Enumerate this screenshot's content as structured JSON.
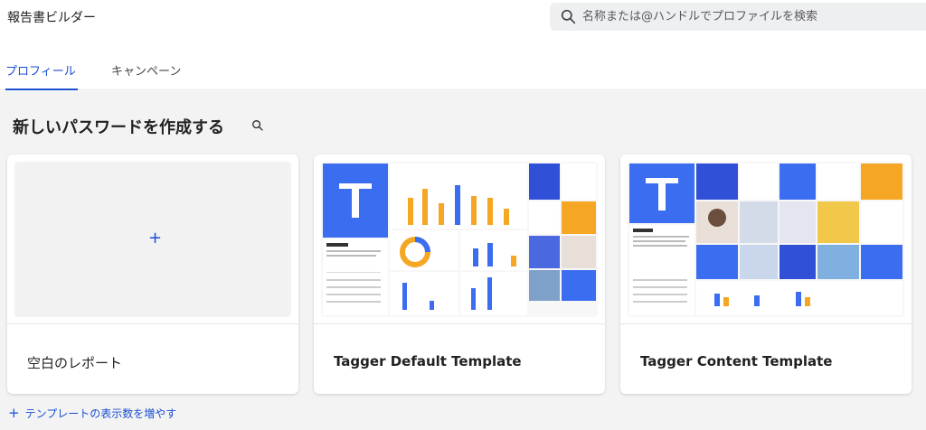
{
  "header": {
    "app_title": "報告書ビルダー",
    "search_placeholder": "名称または@ハンドルでプロファイルを検索"
  },
  "tabs": [
    {
      "label": "プロフィール",
      "active": true
    },
    {
      "label": "キャンペーン",
      "active": false
    }
  ],
  "section": {
    "title": "新しいパスワードを作成する"
  },
  "cards": [
    {
      "label": "空白のレポート",
      "plus": "+"
    },
    {
      "label": "Tagger Default Template"
    },
    {
      "label": "Tagger Content Template"
    }
  ],
  "more_link": {
    "plus": "+",
    "label": "テンプレートの表示数を増やす"
  },
  "colors": {
    "accent": "#1a4fd0",
    "page_bg": "#f3f3f3",
    "brand_blue": "#3b6df0",
    "chart_orange": "#f5a623"
  }
}
